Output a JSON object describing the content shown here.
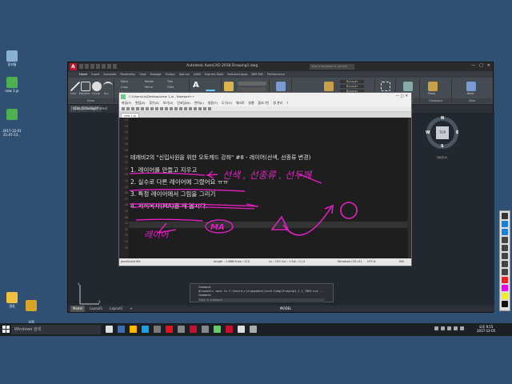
{
  "desktop": {
    "icons": [
      {
        "label": "휴지통",
        "color": "#8bb0d6"
      },
      {
        "label": "new 1.jo",
        "color": "#4caf50"
      },
      {
        "label": "2017-12-01\n21-07-13...",
        "color": "#4caf50"
      },
      {
        "label": "영상",
        "color": "#f0c040"
      },
      {
        "label": "오캠\n단축키모음",
        "color": "#d9a528"
      }
    ]
  },
  "autocad": {
    "title": "Autodesk AutoCAD 2018    Drawing1.dwg",
    "search_placeholder": "Type a keyword or phrase",
    "window_buttons": [
      "—",
      "□",
      "✕"
    ],
    "ribbon_tabs": [
      "Home",
      "Insert",
      "Annotate",
      "Parametric",
      "View",
      "Manage",
      "Output",
      "Add-ins",
      "A360",
      "Express Tools",
      "Featured Apps",
      "BIM 360",
      "Performance"
    ],
    "ribbon_groups": [
      {
        "label": "Draw",
        "buttons": [
          "Line",
          "Polyline",
          "Circle",
          "Arc"
        ]
      },
      {
        "label": "Modify",
        "buttons": [
          "Move",
          "Rotate",
          "Trim",
          "Copy",
          "Mirror",
          "Fillet",
          "Stretch",
          "Scale",
          "Array"
        ]
      },
      {
        "label": "Annotation",
        "buttons": [
          "Text",
          "Dimension"
        ]
      },
      {
        "label": "Layers",
        "buttons": [
          "Layer Properties"
        ]
      },
      {
        "label": "Block",
        "buttons": [
          "Insert"
        ]
      },
      {
        "label": "Properties",
        "buttons": [
          "Match Properties",
          "ByLayer",
          "ByLayer",
          "ByLayer"
        ]
      },
      {
        "label": "Groups",
        "buttons": [
          "Group"
        ]
      },
      {
        "label": "Utilities",
        "buttons": [
          "Measure"
        ]
      },
      {
        "label": "Clipboard",
        "buttons": [
          "Paste"
        ]
      },
      {
        "label": "View",
        "buttons": [
          "Base"
        ]
      }
    ],
    "file_tab": "Start    Drawing1*",
    "viewport_label": "[-][Top][2D Wireframe]",
    "viewcube": {
      "top_face": "TOP",
      "n": "N",
      "s": "S",
      "e": "E",
      "w": "W",
      "wcs": "WCS ▾"
    },
    "layout_tabs": [
      "Model",
      "Layout1",
      "Layout2",
      "+"
    ],
    "status_model": "MODEL",
    "commandline": {
      "lines": [
        "Command:",
        "Automatic save to C:\\Users\\rjs\\appdata\\local\\temp\\Drawing1_1_1_7063.sv$ ...",
        "Command:"
      ],
      "input_placeholder": "Type a command"
    }
  },
  "editor": {
    "title": "C:\\Users\\rjs\\Desktop\\new 1.jo - Notepad++",
    "menu": [
      "파일(F)",
      "편집(E)",
      "찾기(S)",
      "보기(V)",
      "인코딩(N)",
      "언어(L)",
      "설정(T)",
      "도구(O)",
      "매크로",
      "실행",
      "플러그인",
      "창 관리",
      "?"
    ],
    "file_tab": "new 1.jo",
    "lines": [
      {
        "num": "14",
        "text": ""
      },
      {
        "num": "15",
        "text": ""
      },
      {
        "num": "16",
        "text": ""
      },
      {
        "num": "17",
        "text": ""
      },
      {
        "num": "18",
        "text": ""
      },
      {
        "num": "19",
        "text": ""
      },
      {
        "num": "20",
        "text": "테레비2의 \"신입사원을 위한 오토캐드 강좌\" #8 - 레이어(선색, 선종류 변경)"
      },
      {
        "num": "21",
        "text": ""
      },
      {
        "num": "22",
        "text": "1. 레이어를 만들고 지우고"
      },
      {
        "num": "23",
        "text": ""
      },
      {
        "num": "24",
        "text": "2. 실수로 다른 레이어에 그렸어요 ㅠㅠ"
      },
      {
        "num": "25",
        "text": ""
      },
      {
        "num": "26",
        "text": "3. 특정 레이어에서 그림을 그리기"
      },
      {
        "num": "27",
        "text": ""
      },
      {
        "num": "28",
        "text": "4. 서식복사(MA)를 해 봅시다."
      },
      {
        "num": "29",
        "text": ""
      },
      {
        "num": "30",
        "text": ""
      },
      {
        "num": "31",
        "text": ""
      },
      {
        "num": "32",
        "text": ""
      },
      {
        "num": "33",
        "text": ""
      },
      {
        "num": "34",
        "text": ""
      },
      {
        "num": "35",
        "text": ""
      }
    ],
    "annotations": [
      "선색 , 선종류 , 선두께",
      "레이어",
      "MA"
    ],
    "status": {
      "filetype": "JavaScript file",
      "length": "length : 1,866    lines : 210",
      "position": "Ln : 152    Col : 1    Sel : 0 | 0",
      "eol": "Windows (CR LF)",
      "encoding": "UTF-8",
      "mode": "INS"
    }
  },
  "taskbar": {
    "search_placeholder": "Windows 검색",
    "app_colors": [
      "#e0e0e0",
      "#3a6db5",
      "#ffb900",
      "#1ba1e2",
      "#7a7a7a",
      "#e81123",
      "#888888",
      "#c8102e",
      "#888888",
      "#6c6",
      "#c8102e",
      "#dddddd",
      "#aaaaaa"
    ],
    "clock_time": "오후 9:15",
    "clock_date": "2017-12-05"
  }
}
